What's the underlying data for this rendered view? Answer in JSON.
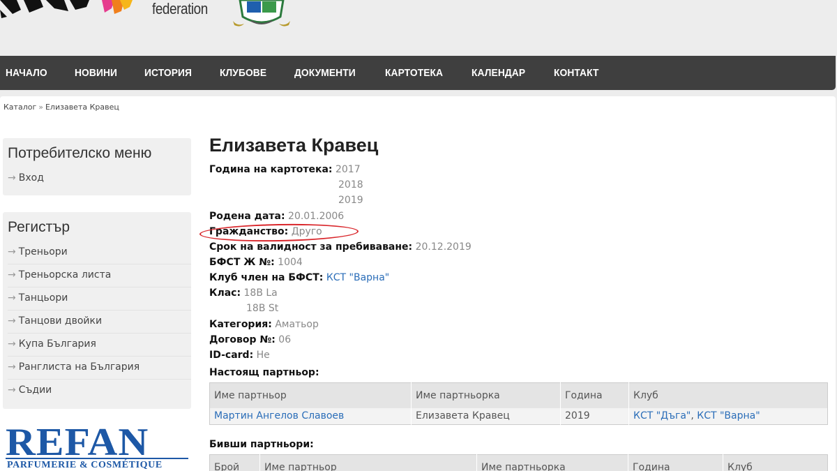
{
  "header": {
    "federation_text": "federation"
  },
  "nav": {
    "items": [
      "НАЧАЛО",
      "НОВИНИ",
      "ИСТОРИЯ",
      "КЛУБОВЕ",
      "ДОКУМЕНТИ",
      "КАРТОТЕКА",
      "КАЛЕНДАР",
      "КОНТАКТ"
    ]
  },
  "breadcrumb": {
    "catalog": "Каталог",
    "separator": "»",
    "current": "Елизавета Кравец"
  },
  "sidebar": {
    "user_menu": {
      "title": "Потребителско меню",
      "items": [
        "Вход"
      ]
    },
    "register": {
      "title": "Регистър",
      "items": [
        "Треньори",
        "Треньорска листа",
        "Танцьори",
        "Танцови двойки",
        "Купа България",
        "Ранглиста на България",
        "Съдии"
      ]
    },
    "arrow_glyph": "→",
    "sponsor": {
      "name": "REFAN",
      "tagline": "PARFUMERIE & COSMÉTIQUE"
    }
  },
  "profile": {
    "name": "Елизавета Кравец",
    "year_label": "Година на картотека:",
    "years": [
      "2017",
      "2018",
      "2019"
    ],
    "birth_label": "Родена дата:",
    "birth_value": "20.01.2006",
    "citizenship_label": "Гражданство:",
    "citizenship_value": "Друго",
    "residence_label": "Срок на валидност за пребиваване:",
    "residence_value": "20.12.2019",
    "bfst_label": "БФСТ Ж №:",
    "bfst_value": "1004",
    "club_label": "Клуб член на БФСТ:",
    "club_value": "КСТ \"Варна\"",
    "class_label": "Клас:",
    "classes": [
      "18B La",
      "18B St"
    ],
    "category_label": "Категория:",
    "category_value": "Аматьор",
    "contract_label": "Договор №:",
    "contract_value": "06",
    "idcard_label": "ID-card:",
    "idcard_value": "Не"
  },
  "current_partner": {
    "heading": "Настоящ партньор:",
    "columns": [
      "Име партньор",
      "Име партньорка",
      "Година",
      "Клуб"
    ],
    "row": {
      "partner": "Мартин Ангелов Славоев",
      "partner_female": "Елизавета Кравец",
      "year": "2019",
      "club1": "КСТ \"Дъга\"",
      "club_sep": ", ",
      "club2": "КСТ \"Варна\""
    }
  },
  "past_partners": {
    "heading": "Бивши партньори:",
    "columns": [
      "Брой",
      "Име партньор",
      "Име партньорка",
      "Година",
      "Клуб"
    ]
  },
  "colors": {
    "nav_bg": "#3f3f3f",
    "link": "#2a6db8",
    "highlight": "#d9262b",
    "sponsor": "#1d58a6"
  }
}
